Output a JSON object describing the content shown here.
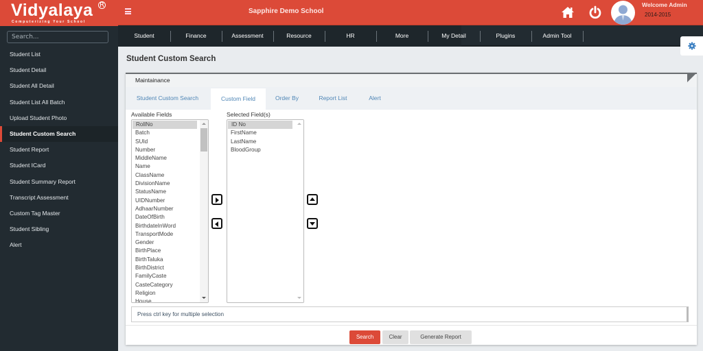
{
  "brand": {
    "logo": "Vidyalaya",
    "registered": "R",
    "tagline": "Computerizing Your School",
    "primary_color": "#dc4a38",
    "sidebar_color": "#222b31"
  },
  "sidebar": {
    "search_placeholder": "Search...",
    "items": [
      {
        "label": "Student List"
      },
      {
        "label": "Student Detail"
      },
      {
        "label": "Student All Detail"
      },
      {
        "label": "Student List All Batch"
      },
      {
        "label": "Upload Student Photo"
      },
      {
        "label": "Student Custom Search",
        "active": true
      },
      {
        "label": "Student Report"
      },
      {
        "label": "Student ICard"
      },
      {
        "label": "Student Summary Report"
      },
      {
        "label": "Transcript Assessment"
      },
      {
        "label": "Custom Tag Master"
      },
      {
        "label": "Student Sibling"
      },
      {
        "label": "Alert"
      }
    ]
  },
  "header": {
    "school_name": "Sapphire Demo School",
    "welcome": "Welcome Admin",
    "academic_year": "2014-2015",
    "icons": [
      "menu-icon",
      "home-icon",
      "power-icon",
      "avatar"
    ]
  },
  "nav": {
    "items": [
      "Student",
      "Finance",
      "Assessment",
      "Resource",
      "HR",
      "More",
      "My Detail",
      "Plugins",
      "Admin Tool"
    ]
  },
  "page": {
    "title": "Student Custom Search",
    "panel_title": "Maintainance",
    "tabs": [
      {
        "label": "Student Custom Search"
      },
      {
        "label": "Custom Field",
        "active": true
      },
      {
        "label": "Order By"
      },
      {
        "label": "Report List"
      },
      {
        "label": "Alert"
      }
    ],
    "available_label": "Available Fields",
    "selected_label": "Selected Field(s)",
    "available_fields": [
      "RollNo",
      "Batch",
      "SUId",
      "Number",
      "MiddleName",
      "Name",
      "ClassName",
      "DivisionName",
      "StatusName",
      "UIDNumber",
      "AdhaarNumber",
      "DateOfBirth",
      "BirthdateInWord",
      "TransportMode",
      "Gender",
      "BirthPlace",
      "BirthTaluka",
      "BirthDistrict",
      "FamilyCaste",
      "CasteCategory",
      "Religion",
      "House"
    ],
    "available_selected": "RollNo",
    "selected_fields": [
      "ID No",
      "FirstName",
      "LastName",
      "BloodGroup"
    ],
    "selected_selected": "ID No",
    "hint": "Press ctrl key for multiple selection",
    "buttons": {
      "search": "Search",
      "clear": "Clear",
      "report": "Generate Report"
    }
  }
}
